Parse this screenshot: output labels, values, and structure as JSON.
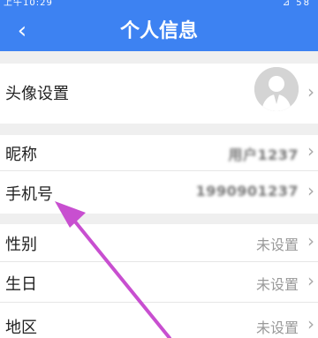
{
  "statusbar": {
    "time": "上午10:29",
    "right": "⊿ 58"
  },
  "header": {
    "back_icon": "chevron-left-icon",
    "title": "个人信息"
  },
  "rows": [
    {
      "label": "头像设置",
      "value": ""
    },
    {
      "label": "昵称",
      "value": "用户1237"
    },
    {
      "label": "手机号",
      "value": "1990901237"
    },
    {
      "label": "性别",
      "value": "未设置"
    },
    {
      "label": "生日",
      "value": "未设置"
    },
    {
      "label": "地区",
      "value": "未设置"
    }
  ],
  "colors": {
    "header": "#3d82f2",
    "arrow": "#c84fd0"
  }
}
